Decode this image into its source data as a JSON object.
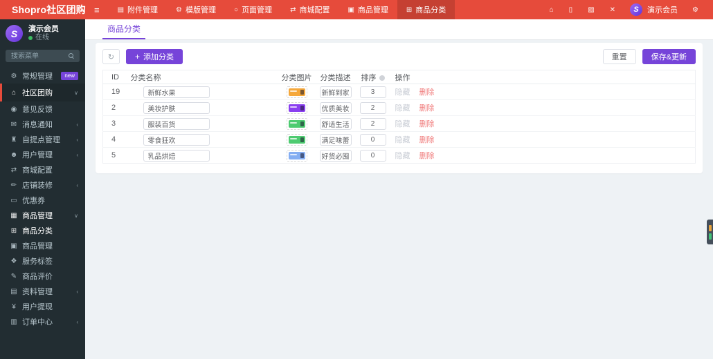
{
  "colors": {
    "topbar_red": "#e64b3b",
    "sidebar_dark": "#222d32",
    "accent_purple": "#7644d9",
    "danger_red": "#f07a7a",
    "online_green": "#3dbb61"
  },
  "topbar": {
    "logo": "Shopro社区团购",
    "hamburger_glyph": "≡",
    "nav": [
      {
        "icon": "file-icon",
        "glyph": "▤",
        "label": "附件管理"
      },
      {
        "icon": "cogs-icon",
        "glyph": "⚙",
        "label": "模版管理"
      },
      {
        "icon": "circle-icon",
        "glyph": "○",
        "label": "页面管理"
      },
      {
        "icon": "sliders-icon",
        "glyph": "⇄",
        "label": "商城配置"
      },
      {
        "icon": "bag-icon",
        "glyph": "▣",
        "label": "商品管理"
      },
      {
        "icon": "sitemap-icon",
        "glyph": "⊞",
        "label": "商品分类",
        "active": true
      }
    ],
    "right": {
      "home_glyph": "⌂",
      "trash_glyph": "▯",
      "refresh_glyph": "▨",
      "fullscreen_glyph": "✕",
      "avatar_text": "S",
      "user_name": "演示会员",
      "settings_glyph": "⚙"
    }
  },
  "sidebar": {
    "user": {
      "avatar_text": "S",
      "name": "演示会员",
      "status": "在线"
    },
    "search_placeholder": "搜索菜单",
    "menu": [
      {
        "glyph": "⚙",
        "label": "常规管理",
        "badge": "new"
      },
      {
        "glyph": "⌂",
        "label": "社区团购",
        "chev": "∨"
      },
      {
        "glyph": "◉",
        "label": "意见反馈"
      },
      {
        "glyph": "✉",
        "label": "消息通知",
        "chev": "‹"
      },
      {
        "glyph": "♜",
        "label": "自提点管理",
        "chev": "‹"
      },
      {
        "glyph": "☻",
        "label": "用户管理",
        "chev": "‹"
      },
      {
        "glyph": "⇄",
        "label": "商城配置"
      },
      {
        "glyph": "✏",
        "label": "店铺装修",
        "chev": "‹"
      },
      {
        "glyph": "▭",
        "label": "优惠券"
      },
      {
        "glyph": "▦",
        "label": "商品管理",
        "chev": "∨"
      },
      {
        "glyph": "⊞",
        "label": "商品分类"
      },
      {
        "glyph": "▣",
        "label": "商品管理"
      },
      {
        "glyph": "❖",
        "label": "服务标签"
      },
      {
        "glyph": "✎",
        "label": "商品评价"
      },
      {
        "glyph": "▤",
        "label": "资料管理",
        "chev": "‹"
      },
      {
        "glyph": "¥",
        "label": "用户提现"
      },
      {
        "glyph": "▥",
        "label": "订单中心",
        "chev": "‹"
      }
    ]
  },
  "main": {
    "tab": "商品分类",
    "toolbar": {
      "refresh_glyph": "↻",
      "add_plus": "+",
      "add_label": "添加分类",
      "reset_label": "重置",
      "save_label": "保存&更新"
    },
    "table": {
      "headers": [
        "ID",
        "分类名称",
        "分类图片",
        "分类描述",
        "排序",
        "操作"
      ],
      "actions": {
        "hide": "隐藏",
        "delete": "删除"
      },
      "rows": [
        {
          "id": "19",
          "name": "新鲜水果",
          "thumb_color": "#f5a83c",
          "desc": "新鲜到家",
          "sort": "3"
        },
        {
          "id": "2",
          "name": "美妆护肤",
          "thumb_color": "#8a3ff0",
          "desc": "优质美妆",
          "sort": "2"
        },
        {
          "id": "3",
          "name": "服装百货",
          "thumb_color": "#4ecb71",
          "desc": "舒适生活",
          "sort": "2"
        },
        {
          "id": "4",
          "name": "零食狂欢",
          "thumb_color": "#4ecb71",
          "desc": "满足味蕾",
          "sort": "0"
        },
        {
          "id": "5",
          "name": "乳品烘焙",
          "thumb_color": "#85aef2",
          "desc": "好货必囤",
          "sort": "0"
        }
      ]
    }
  },
  "edge_widget": {
    "bar_colors": [
      "#e8a43d",
      "#42c378"
    ]
  }
}
